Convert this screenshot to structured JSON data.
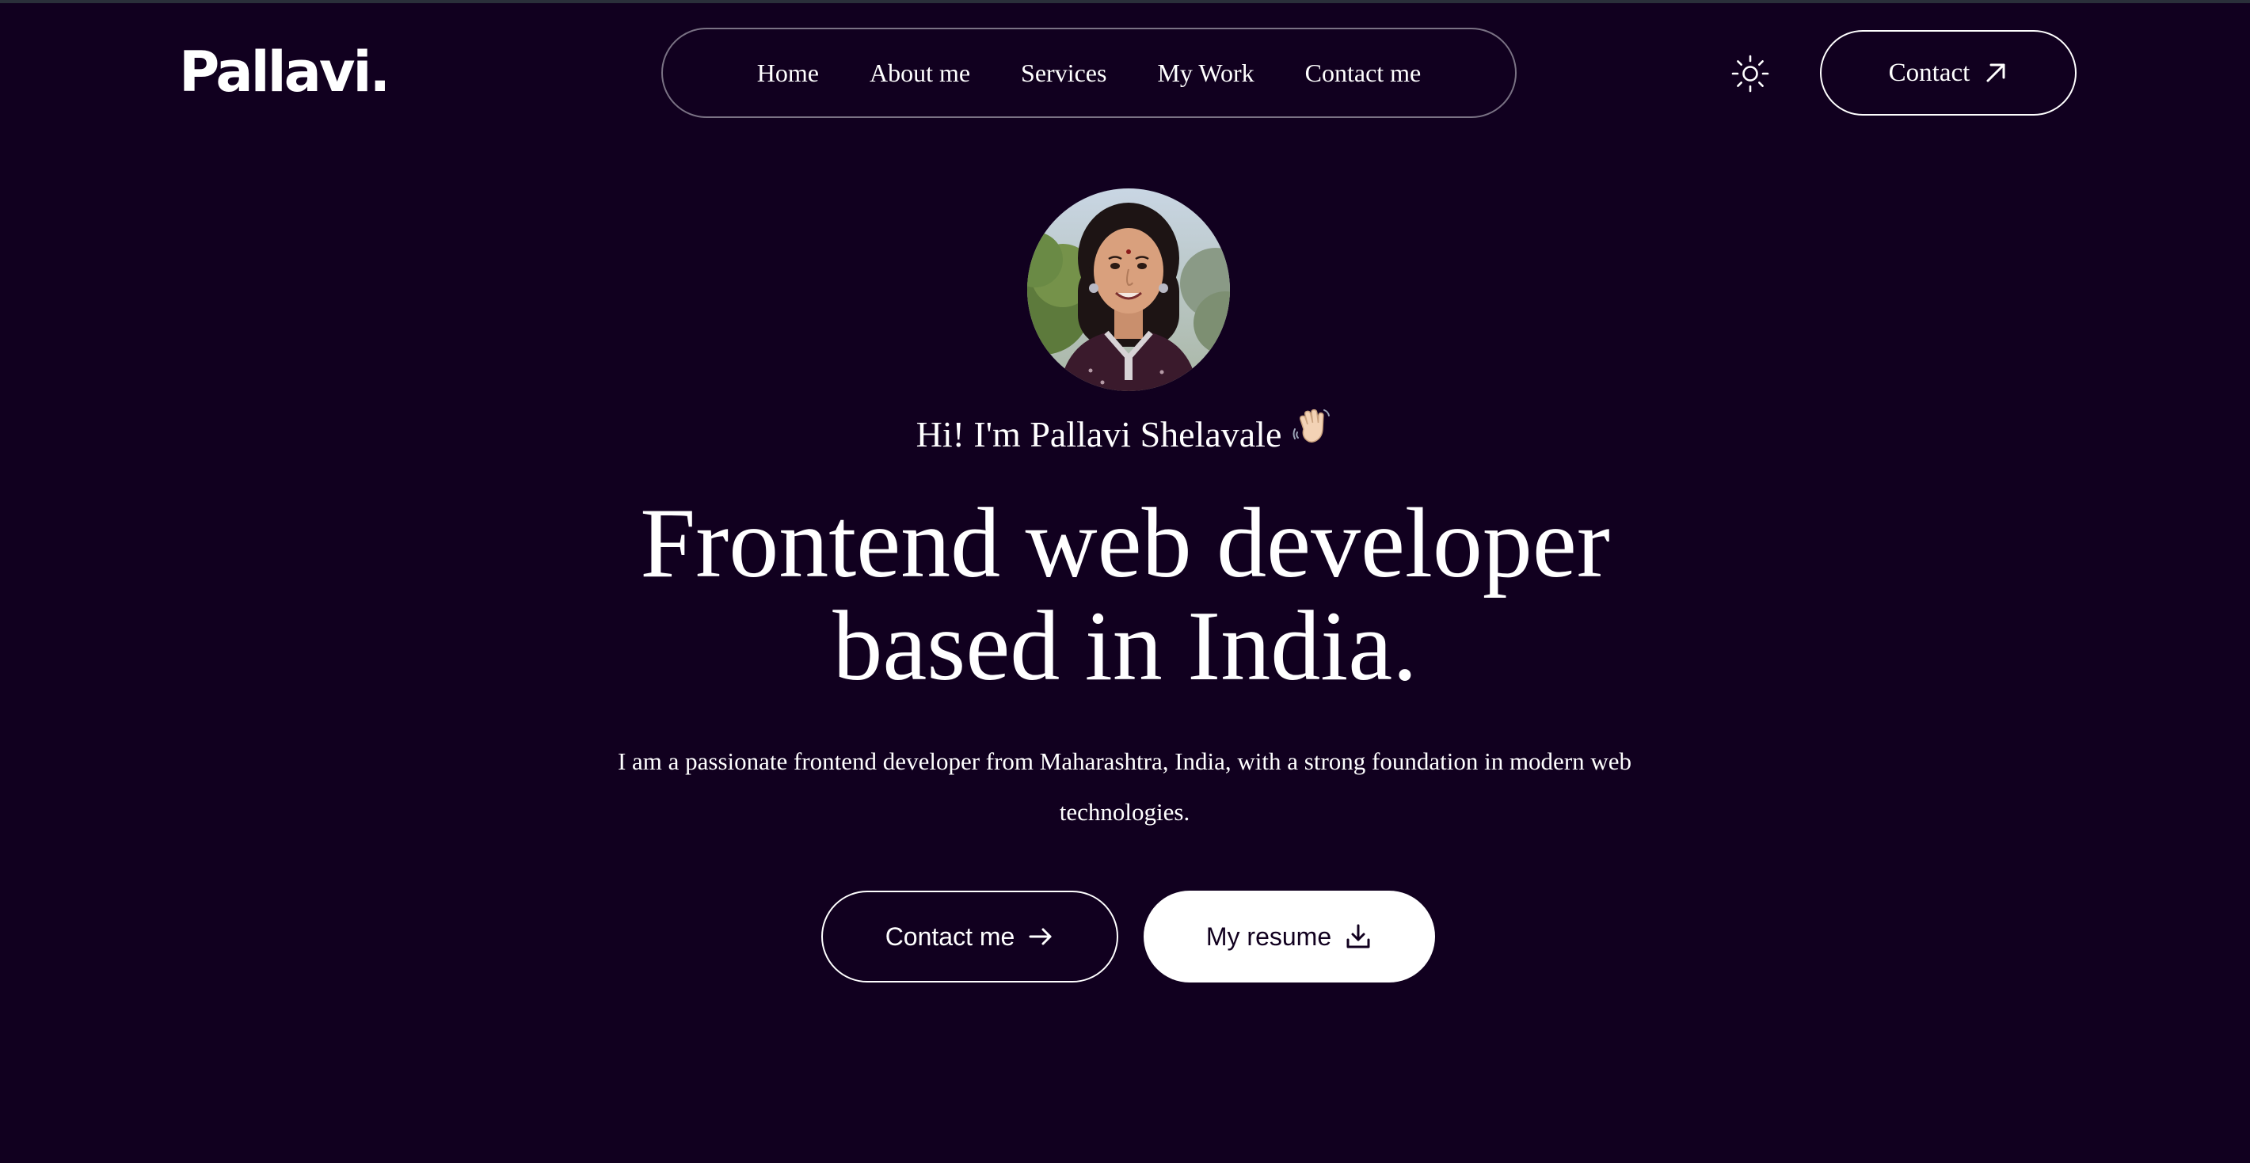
{
  "header": {
    "logo": "Pallavi.",
    "nav_items": [
      {
        "label": "Home"
      },
      {
        "label": "About me"
      },
      {
        "label": "Services"
      },
      {
        "label": "My Work"
      },
      {
        "label": "Contact me"
      }
    ],
    "theme_toggle_icon": "sun-icon",
    "contact_button": {
      "label": "Contact",
      "icon": "arrow-up-right-icon"
    }
  },
  "hero": {
    "avatar_alt": "profile photo",
    "greeting": "Hi! I'm Pallavi Shelavale",
    "greeting_icon": "waving-hand-icon",
    "headline_line1": "Frontend web developer",
    "headline_line2": "based in India.",
    "description": "I am a passionate frontend developer from Maharashtra, India, with a strong foundation in modern web technologies.",
    "primary_button": {
      "label": "Contact me",
      "icon": "arrow-right-icon"
    },
    "secondary_button": {
      "label": "My resume",
      "icon": "download-icon"
    }
  },
  "colors": {
    "background": "#11001f",
    "text": "#ffffff",
    "nav_border": "#7a7284",
    "button_light_bg": "#ffffff"
  }
}
